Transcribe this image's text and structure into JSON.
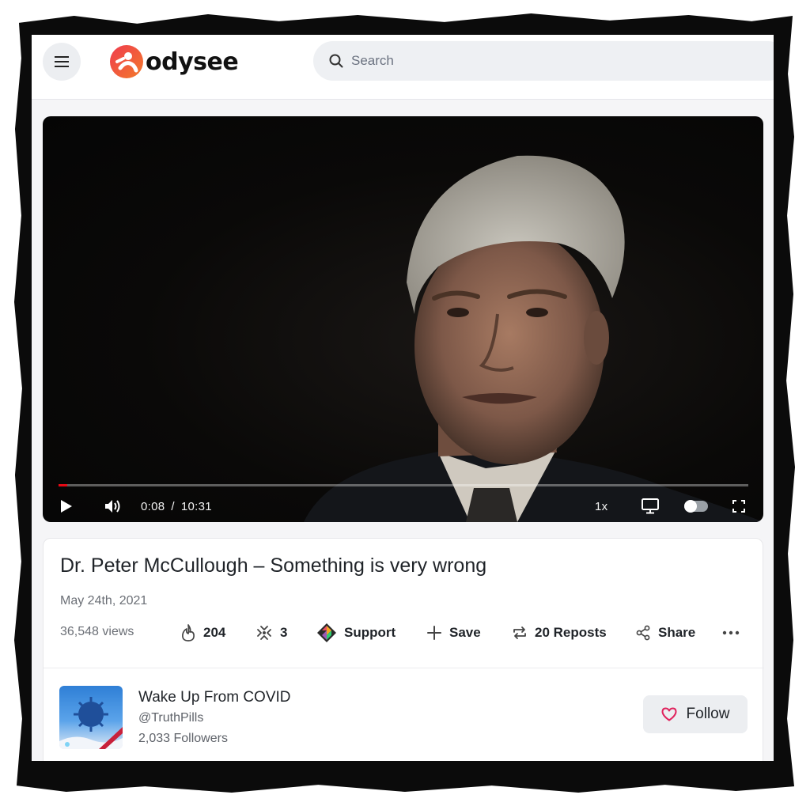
{
  "header": {
    "logo_text": "odysee",
    "search_placeholder": "Search"
  },
  "player": {
    "current_time": "0:08",
    "separator": "/",
    "duration": "10:31",
    "progress_fraction": 0.0127,
    "speed": "1x"
  },
  "video": {
    "title": "Dr. Peter McCullough – Something is very wrong",
    "date": "May 24th, 2021",
    "views": "36,548 views"
  },
  "actions": {
    "fire_count": "204",
    "slime_count": "3",
    "support_label": "Support",
    "save_label": "Save",
    "reposts_label": "20 Reposts",
    "share_label": "Share"
  },
  "channel": {
    "name": "Wake Up From COVID",
    "handle": "@TruthPills",
    "followers": "2,033 Followers",
    "follow_label": "Follow"
  },
  "colors": {
    "progress": "#e50914",
    "follow_heart": "#e0245e",
    "logo_accent": "#ef3b4f"
  }
}
